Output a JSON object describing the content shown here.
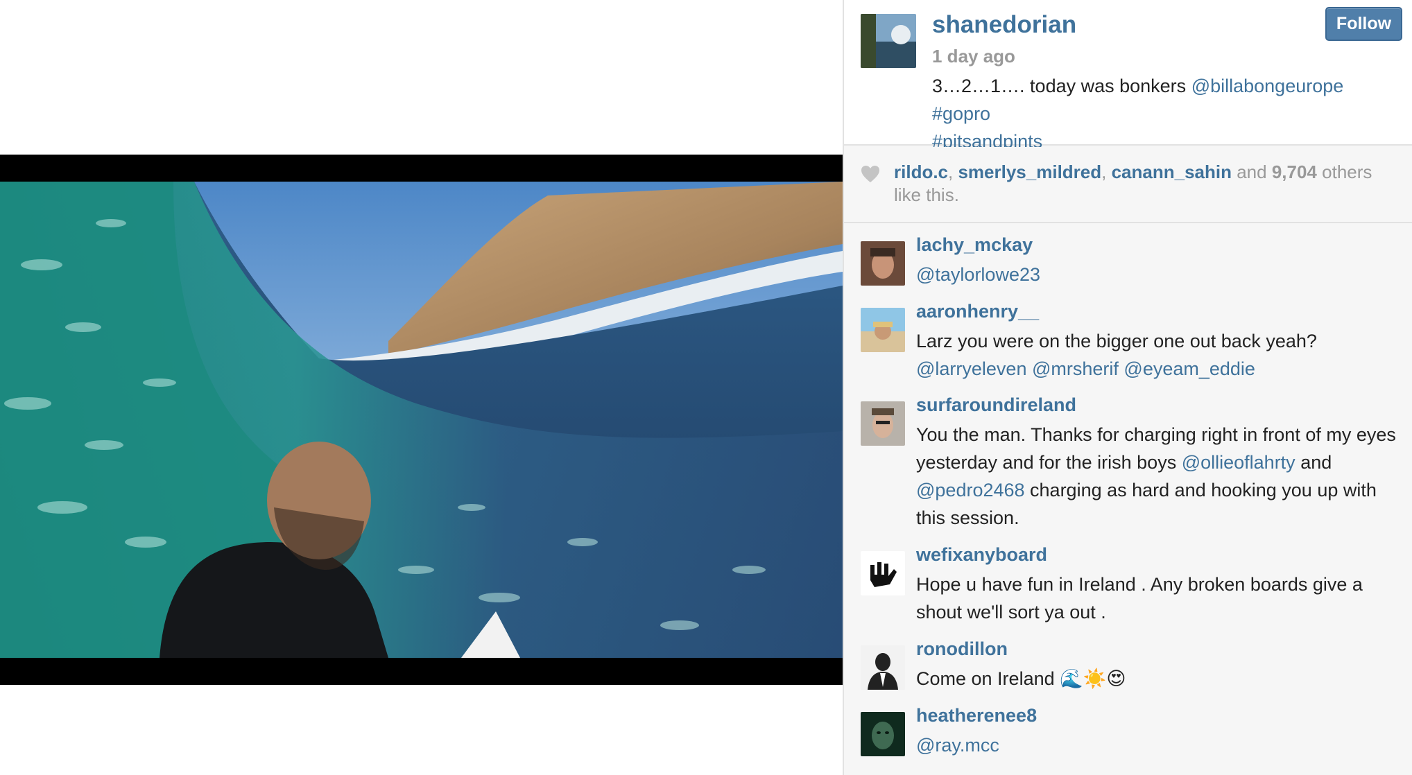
{
  "post": {
    "username": "shanedorian",
    "time": "1 day ago",
    "caption_text": "3…2…1…. today was bonkers ",
    "caption_mention": "@billabongeurope",
    "caption_tag1": " #gopro",
    "caption_tag2": "#pitsandpints",
    "follow_label": "Follow"
  },
  "likes": {
    "user1": "rildo.c",
    "sep1": ", ",
    "user2": "smerlys_mildred",
    "sep2": ", ",
    "user3": "canann_sahin",
    "and": " and ",
    "count": "9,704",
    "suffix": " others like this."
  },
  "comments": [
    {
      "user": "lachy_mckay",
      "parts": [
        {
          "text": "@taylorlowe23",
          "link": true
        }
      ]
    },
    {
      "user": "aaronhenry__",
      "parts": [
        {
          "text": "Larz you were on the bigger one out back yeah? ",
          "link": false
        },
        {
          "text": "@larryeleven",
          "link": true
        },
        {
          "text": " ",
          "link": false
        },
        {
          "text": "@mrsherif",
          "link": true
        },
        {
          "text": " ",
          "link": false
        },
        {
          "text": "@eyeam_eddie",
          "link": true
        }
      ]
    },
    {
      "user": "surfaroundireland",
      "parts": [
        {
          "text": "You the man. Thanks for charging right in front of my eyes yesterday and for the irish boys ",
          "link": false
        },
        {
          "text": "@ollieoflahrty",
          "link": true
        },
        {
          "text": " and ",
          "link": false
        },
        {
          "text": "@pedro2468",
          "link": true
        },
        {
          "text": " charging as hard and hooking you up with this session.",
          "link": false
        }
      ]
    },
    {
      "user": "wefixanyboard",
      "parts": [
        {
          "text": "Hope u have fun in Ireland . Any broken boards give a shout we'll sort ya out .",
          "link": false
        }
      ]
    },
    {
      "user": "ronodillon",
      "parts": [
        {
          "text": "Come on Ireland 🌊☀️😍",
          "link": false
        }
      ]
    },
    {
      "user": "heatherenee8",
      "parts": [
        {
          "text": "@ray.mcc",
          "link": true
        }
      ]
    }
  ],
  "colors": {
    "link": "#3f729b",
    "follow_button": "#507faa",
    "muted": "#999999"
  }
}
